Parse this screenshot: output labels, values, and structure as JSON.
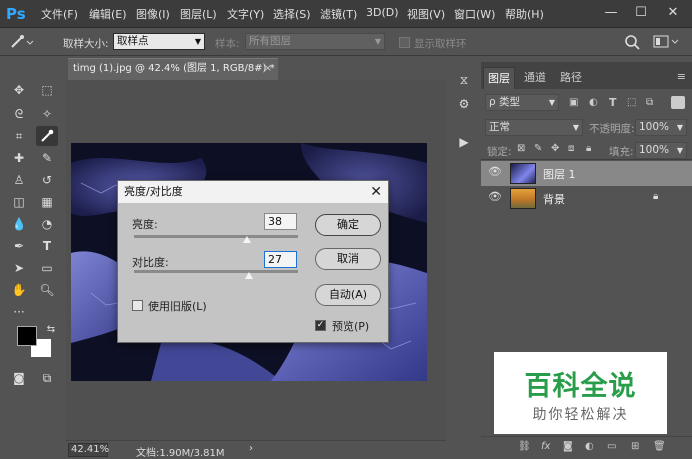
{
  "app": {
    "logo": "Ps"
  },
  "menu": [
    "文件(F)",
    "编辑(E)",
    "图像(I)",
    "图层(L)",
    "文字(Y)",
    "选择(S)",
    "滤镜(T)",
    "3D(D)",
    "视图(V)",
    "窗口(W)",
    "帮助(H)"
  ],
  "window_controls": {
    "minimize": "—",
    "maximize": "☐",
    "close": "✕"
  },
  "options_bar": {
    "sample_size_label": "取样大小:",
    "sample_size_value": "取样点",
    "sample_label": "样本:",
    "sample_value": "所有图层",
    "show_ring_label": "显示取样环"
  },
  "document": {
    "tab_title": "timg (1).jpg @ 42.4% (图层 1, RGB/8#) *",
    "tab_close": "×",
    "zoom": "42.41%",
    "doc_info": "文档:1.90M/3.81M"
  },
  "dialog": {
    "title": "亮度/对比度",
    "close": "✕",
    "brightness_label": "亮度:",
    "brightness_value": "38",
    "contrast_label": "对比度:",
    "contrast_value": "27",
    "ok": "确定",
    "cancel": "取消",
    "auto": "自动(A)",
    "legacy_label": "使用旧版(L)",
    "legacy_checked": false,
    "preview_label": "预览(P)",
    "preview_checked": true,
    "brightness_fraction": 0.69,
    "contrast_fraction": 0.7
  },
  "layers_panel": {
    "tabs": [
      "图层",
      "通道",
      "路径"
    ],
    "filter_type": "ρ 类型",
    "blend_mode": "正常",
    "opacity_label": "不透明度:",
    "opacity_value": "100%",
    "lock_label": "锁定:",
    "fill_label": "填充:",
    "fill_value": "100%",
    "layers": [
      {
        "name": "图层 1",
        "selected": true
      },
      {
        "name": "背景",
        "selected": false,
        "locked": true
      }
    ]
  },
  "watermark": {
    "title": "百科全说",
    "subtitle": "助你轻松解决"
  },
  "colors": {
    "accent": "#31a8ff",
    "watermark_green": "#2a9d4a",
    "foreground": "#000000",
    "background": "#ffffff"
  }
}
